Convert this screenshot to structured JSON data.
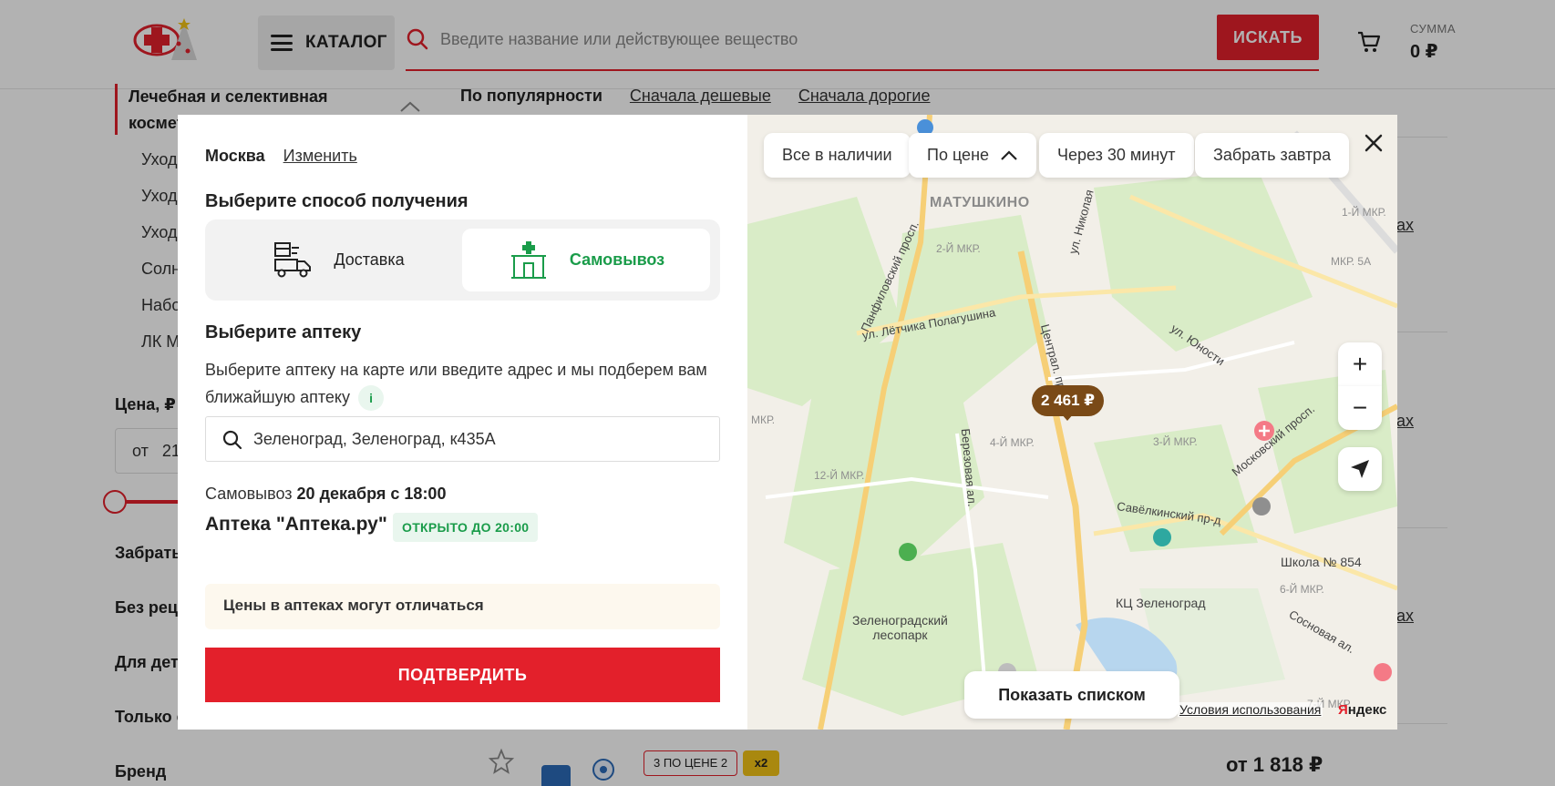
{
  "header": {
    "catalog_label": "КАТАЛОГ",
    "search_placeholder": "Введите название или действующее вещество",
    "search_button": "ИСКАТЬ",
    "sum_label": "СУММА",
    "sum_value": "0 ₽"
  },
  "sidebar": {
    "category_title": "Лечебная и селективная косметика",
    "subitems": [
      "Уход",
      "Уход",
      "Уход",
      "Солн",
      "Набо",
      "ЛК М"
    ],
    "price_title": "Цена, ₽",
    "price_from_prefix": "от",
    "price_from_value": "21",
    "filters": [
      "Забрать",
      "Без реце",
      "Для дет",
      "Только с",
      "Бренд"
    ]
  },
  "sorting": {
    "active": "По популярности",
    "cheap_first": "Сначала дешевые",
    "expensive_first": "Сначала дорогие"
  },
  "results": {
    "link_fragment": "ах",
    "promo_badge": "3 ПО ЦЕНЕ 2",
    "x2_badge": "x2",
    "price": "от 1 818 ₽"
  },
  "modal": {
    "city": "Москва",
    "change_city": "Изменить",
    "method_title": "Выберите способ получения",
    "methods": {
      "delivery": "Доставка",
      "pickup": "Самовывоз"
    },
    "selected_method": "pickup",
    "pharmacy_title": "Выберите аптеку",
    "pharmacy_text": "Выберите аптеку на карте или введите адрес и мы подберем вам ближайшую аптеку",
    "info_icon_label": "i",
    "address_value": "Зеленоград, Зеленоград, к435А",
    "pickup_prefix": "Самовывоз",
    "pickup_time": "20 декабря с 18:00",
    "pharmacy_name": "Аптека \"Аптека.ру\"",
    "open_status": "ОТКРЫТО ДО 20:00",
    "note": "Цены в аптеках могут отличаться",
    "confirm": "ПОДТВЕРДИТЬ"
  },
  "map": {
    "filters": [
      "Все в наличии",
      "По цене",
      "Через 30 минут",
      "Забрать завтра"
    ],
    "district": "МАТУШКИНО",
    "price_pin": "2 461 ₽",
    "show_list": "Показать списком",
    "terms": "Условия использования",
    "brand_first": "Я",
    "brand_rest": "ндекс",
    "zoom_in": "+",
    "zoom_out": "−",
    "labels": {
      "mkr2": "2-Й МКР.",
      "mkr1": "1-Й МКР.",
      "mkr5a": "МКР. 5А",
      "mkr3": "3-Й МКР.",
      "mkr4": "4-Й МКР.",
      "mkr12": "12-Й МКР.",
      "mkr6": "6-Й МКР.",
      "mkr7": "7-Й МКР.",
      "mkr_left": "МКР."
    },
    "streets": {
      "panfilov": "Панфилов­ский просп.",
      "polagushina": "ул. Лётчика Полагушина",
      "nikolaeva": "ул. Николая",
      "central": "Централ. просп.",
      "yunosti": "ул. Юности",
      "moscow": "Московский просп.",
      "savelkin": "Савёлкинский пр-д",
      "berezovaya": "Березовая ал.",
      "sosnovaya": "Сосновая ал."
    },
    "pois": {
      "school": "Школа № 854",
      "kc": "КЦ Зеленоград",
      "park_line1": "Зеленоградский",
      "park_line2": "лесопарк"
    }
  },
  "colors": {
    "brand_red": "#e3202b",
    "accent_green": "#1a9c4a",
    "price_pin": "#7a4a17"
  }
}
